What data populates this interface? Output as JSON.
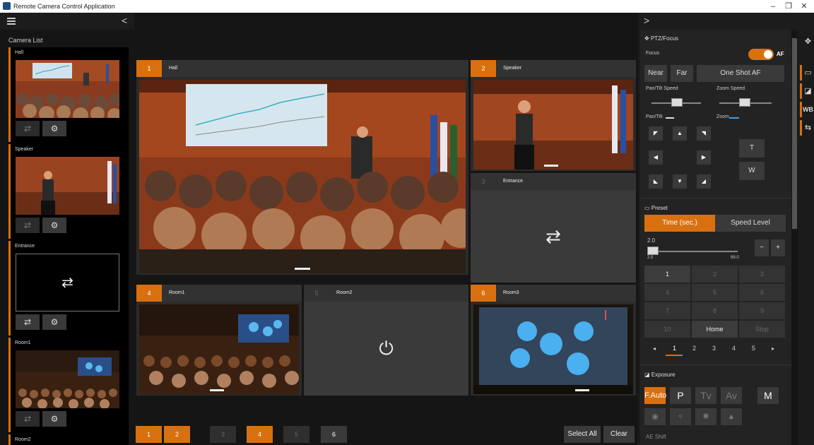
{
  "window": {
    "title": "Remote Camera Control Application",
    "minimize": "–",
    "restore": "❐",
    "close": "✕"
  },
  "left": {
    "collapse_chevron": "<",
    "camera_list_label": "Camera List",
    "cameras": [
      {
        "name": "Hall",
        "swap": "⇄",
        "settings": "⚙"
      },
      {
        "name": "Speaker",
        "swap": "⇄",
        "settings": "⚙"
      },
      {
        "name": "Entrance",
        "swap": "⇄",
        "settings": "⚙",
        "center_icon": "⇄"
      },
      {
        "name": "Room1",
        "swap": "⇄",
        "settings": "⚙"
      },
      {
        "name": "Room2"
      }
    ]
  },
  "tiles": [
    {
      "num": "1",
      "name": "Hall"
    },
    {
      "num": "2",
      "name": "Speaker"
    },
    {
      "num": "3",
      "name": "Entrance",
      "icon": "⇄"
    },
    {
      "num": "4",
      "name": "Room1"
    },
    {
      "num": "5",
      "name": "Room2",
      "icon": "⏻"
    },
    {
      "num": "6",
      "name": "Room3"
    }
  ],
  "bottom": {
    "buttons": [
      "1",
      "2",
      "3",
      "4",
      "5",
      "6"
    ],
    "select_all": "Select All",
    "clear": "Clear"
  },
  "right": {
    "expand_chevron": ">",
    "ptz_title": "PTZ/Focus",
    "focus_label": "Focus",
    "af_label": "AF",
    "af_on": true,
    "near": "Near",
    "far": "Far",
    "one_shot_af": "One Shot AF",
    "pan_tilt_speed": "Pan/Tilt Speed",
    "zoom_speed": "Zoom Speed",
    "pan_tilt": "Pan/Tilt",
    "zoom": "Zoom",
    "tele": "T",
    "wide": "W",
    "preset_title": "Preset",
    "time_tab": "Time (sec.)",
    "speed_level_tab": "Speed Level",
    "time_value": "2.0",
    "time_min": "2.0",
    "time_max": "99.0",
    "minus": "−",
    "plus": "+",
    "preset_buttons": [
      "1",
      "2",
      "3",
      "4",
      "5",
      "6",
      "7",
      "8",
      "9",
      "10",
      "Home",
      "Stop"
    ],
    "pages": [
      "1",
      "2",
      "3",
      "4",
      "5"
    ],
    "page_prev": "◂",
    "page_next": "▸",
    "exposure_title": "Exposure",
    "exposure_modes": [
      "F.Auto",
      "P",
      "Tv",
      "Av",
      "M"
    ],
    "ae_shift": "AE Shift",
    "side_tabs": [
      "PTZ",
      "Preset",
      "Exposure",
      "WB",
      "Scene"
    ],
    "wb_label": "WB"
  },
  "colors": {
    "accent": "#d9700f",
    "bg": "#191919"
  }
}
